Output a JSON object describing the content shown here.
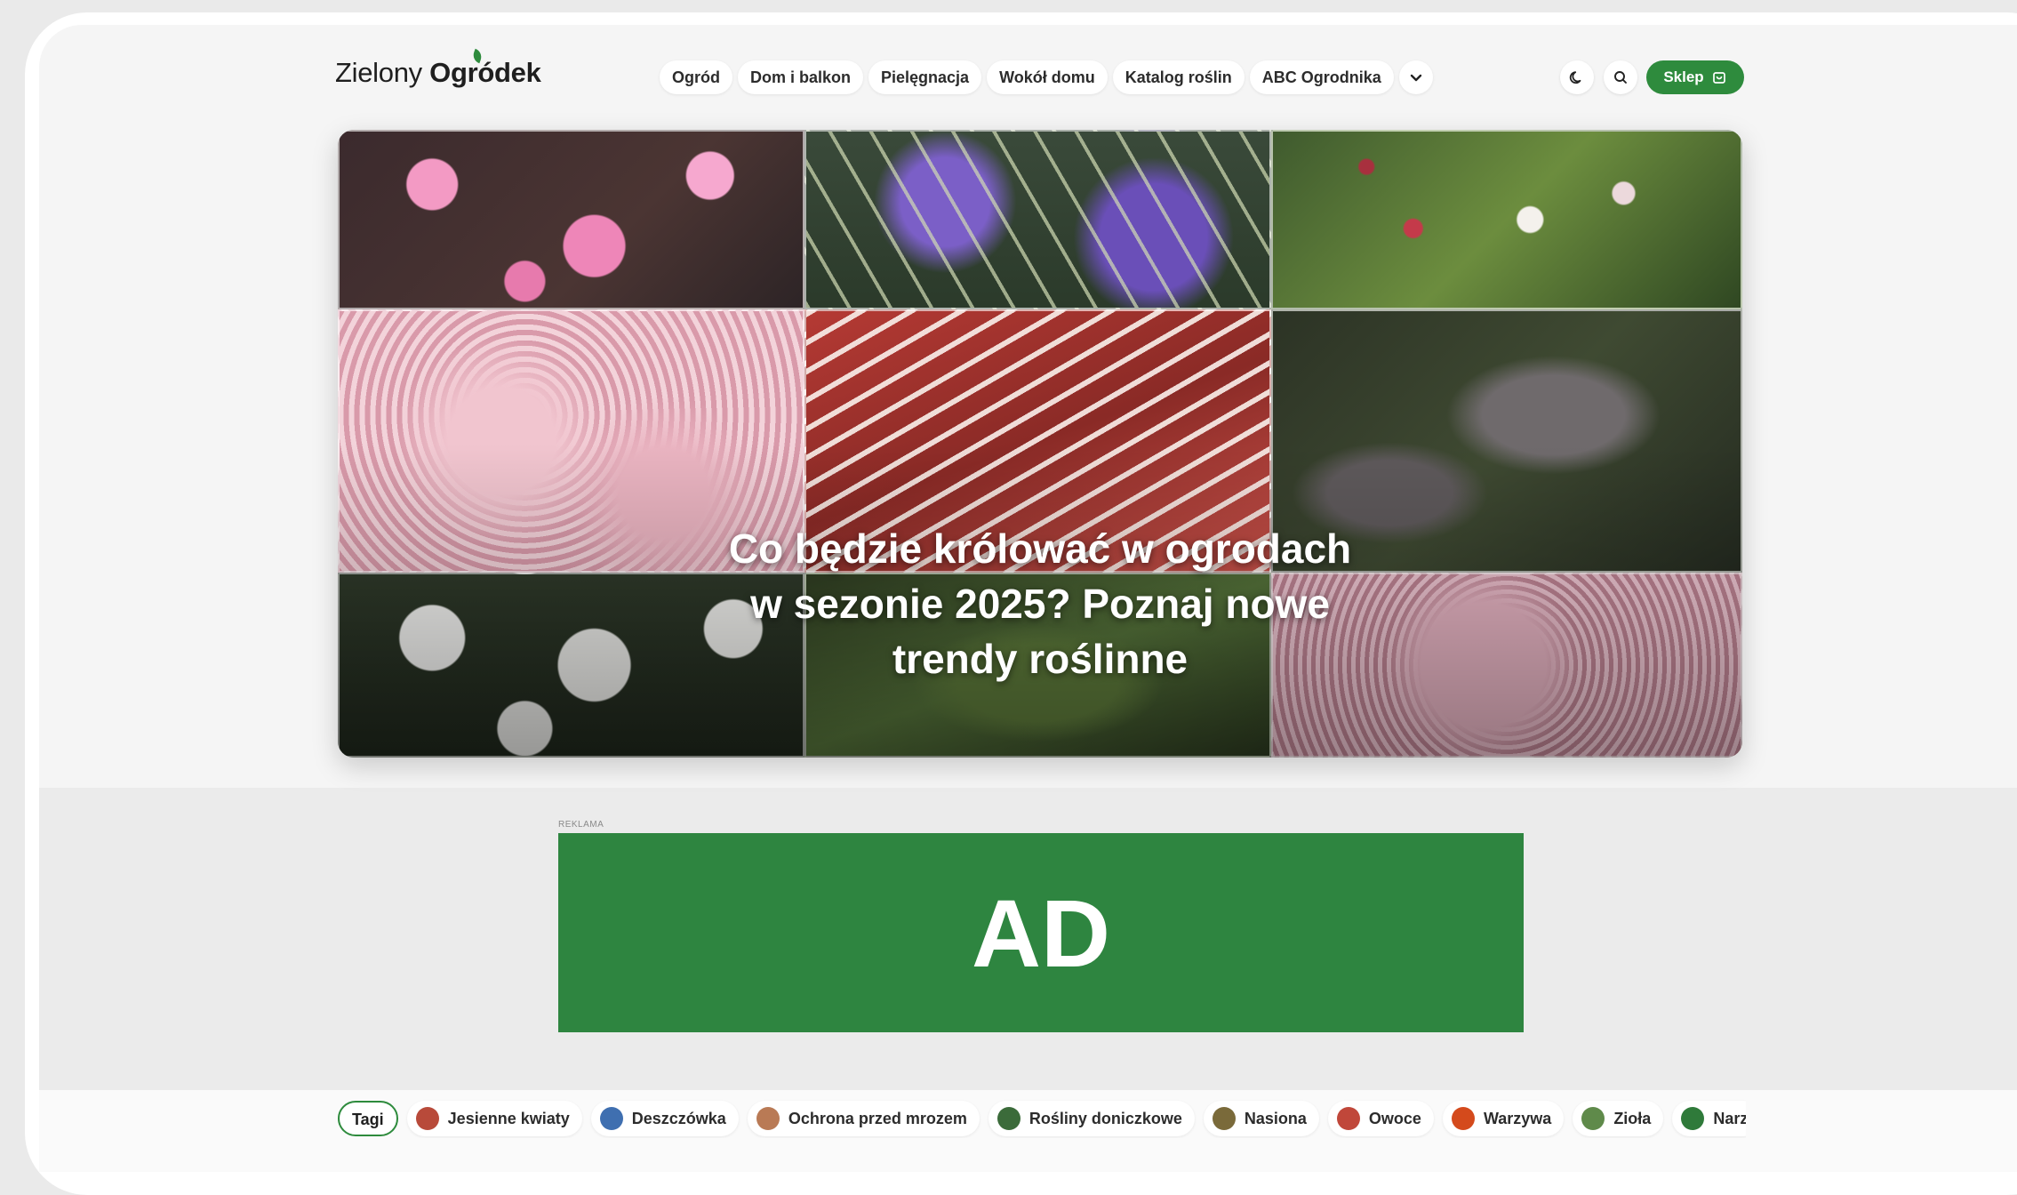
{
  "logo": {
    "part1": "Zielony ",
    "part2": "Ogródek"
  },
  "nav": {
    "items": [
      "Ogród",
      "Dom i balkon",
      "Pielęgnacja",
      "Wokół domu",
      "Katalog roślin",
      "ABC Ogrodnika"
    ],
    "more_icon": "chevron-down-icon"
  },
  "header_actions": {
    "theme_icon": "moon-icon",
    "search_icon": "search-icon",
    "shop_label": "Sklep",
    "shop_icon": "bag-icon"
  },
  "hero": {
    "title": "Co będzie królować w ogrodach w sezonie 2025? Poznaj nowe trendy roślinne"
  },
  "ad": {
    "label": "REKLAMA",
    "text": "AD"
  },
  "tags": {
    "label": "Tagi",
    "items": [
      {
        "label": "Jesienne kwiaty",
        "color": "#b84a3a"
      },
      {
        "label": "Deszczówka",
        "color": "#3f6fb0"
      },
      {
        "label": "Ochrona przed mrozem",
        "color": "#b97a55"
      },
      {
        "label": "Rośliny doniczkowe",
        "color": "#3b6b3a"
      },
      {
        "label": "Nasiona",
        "color": "#7a6a3a"
      },
      {
        "label": "Owoce",
        "color": "#c0473a"
      },
      {
        "label": "Warzywa",
        "color": "#d44a1c"
      },
      {
        "label": "Zioła",
        "color": "#5f8a4a"
      },
      {
        "label": "Narz",
        "color": "#2f7a3a"
      }
    ]
  },
  "colors": {
    "accent": "#2e8b3d",
    "ad_bg": "#2e8540"
  }
}
